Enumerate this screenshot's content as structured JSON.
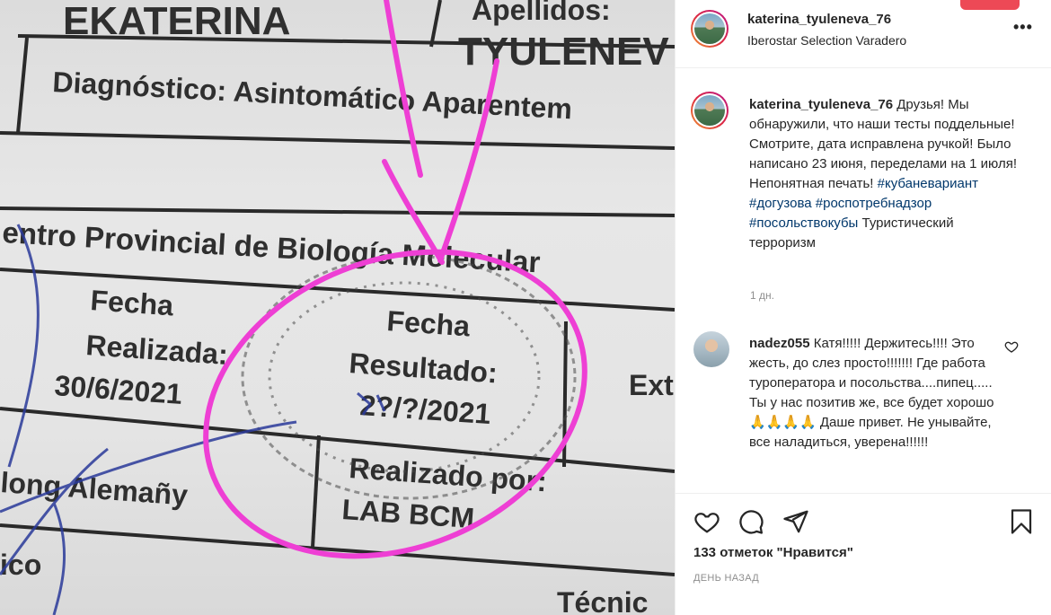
{
  "document": {
    "name_value": "EKATERINA",
    "apellidos_label": "Apellidos:",
    "surname_value": "TYULENEV",
    "diagnostico": "Diagnóstico: Asintomático Aparentem",
    "centro": "entro Provincial de Biología Molecular",
    "fecha_label": "Fecha",
    "realizada_label": "Realizada:",
    "realizada_date": "30/6/2021",
    "fecha2_label": "Fecha",
    "resultado_label": "Resultado:",
    "resultado_date": "2?/?/2021",
    "ext_text": "Ext",
    "aleman_text": "long Alemañy",
    "realizado_por_label": "Realizado por:",
    "lab_text": "LAB BCM",
    "ico_text": "ico",
    "tecnico_text": "Técnic",
    "annotation_color": "#ee3fd4"
  },
  "post": {
    "header": {
      "username": "katerina_tyuleneva_76",
      "location": "Iberostar Selection Varadero",
      "more_label": "•••"
    },
    "caption": {
      "username": "katerina_tyuleneva_76",
      "text": " Друзья! Мы обнаружили, что наши тесты поддельные! Смотрите, дата исправлена ручкой! Было написано 23 июня, переделами на 1 июля! Непонятная печать! ",
      "tags": [
        "#кубаневариант",
        "#догузова",
        "#роспотребнадзор",
        "#посольствокубы"
      ],
      "tail": " Туристический терроризм",
      "time": "1 дн."
    },
    "comments": [
      {
        "username": "nadez055",
        "text": " Катя!!!!! Держитесь!!!! Это жесть, до слез просто!!!!!!! Где работа туроператора и посольства....пипец..... Ты у нас позитив же, все будет хорошо 🙏🙏🙏🙏 Даше привет. Не унывайте, все наладиться, уверена!!!!!!"
      }
    ],
    "likes": "133 отметок \"Нравится\"",
    "date": "ДЕНЬ НАЗАД",
    "icons": {
      "like": "heart-icon",
      "comment": "comment-icon",
      "share": "share-icon",
      "save": "bookmark-icon",
      "more": "more-icon"
    }
  }
}
